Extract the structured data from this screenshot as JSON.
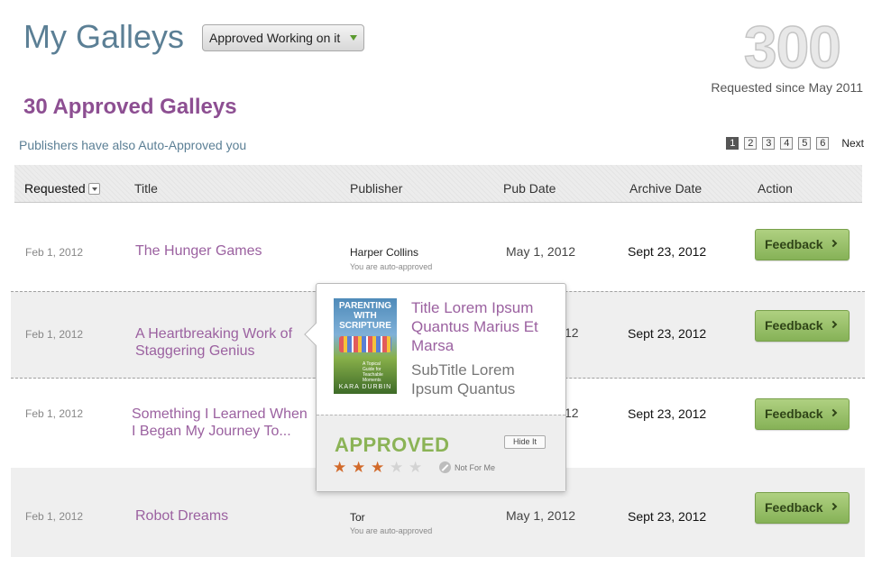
{
  "header": {
    "title": "My Galleys",
    "filter": {
      "selected": "Approved Working on it"
    },
    "stats": {
      "count": "300",
      "label": "Requested since May 2011"
    }
  },
  "section": {
    "title": "30 Approved Galleys",
    "auto_approved_link": "Publishers have also Auto-Approved you"
  },
  "pagination": {
    "pages": [
      "1",
      "2",
      "3",
      "4",
      "5",
      "6"
    ],
    "current": "1",
    "next_label": "Next"
  },
  "table": {
    "columns": {
      "requested": "Requested",
      "title": "Title",
      "publisher": "Publisher",
      "pub_date": "Pub Date",
      "archive_date": "Archive Date",
      "action": "Action"
    },
    "rows": [
      {
        "requested": "Feb 1, 2012",
        "title": "The Hunger Games",
        "publisher": "Harper Collins",
        "publisher_note": "You are auto-approved",
        "pub_date": "May 1, 2012",
        "archive_date": "Sept 23, 2012",
        "action": "Feedback"
      },
      {
        "requested": "Feb 1, 2012",
        "title": "A Heartbreaking Work of Staggering Genius",
        "publisher": "",
        "publisher_note": "",
        "pub_date": "12",
        "archive_date": "Sept 23, 2012",
        "action": "Feedback"
      },
      {
        "requested": "Feb 1, 2012",
        "title": "Something I Learned When I Began My Journey To...",
        "publisher": "",
        "publisher_note": "",
        "pub_date": "12",
        "archive_date": "Sept 23, 2012",
        "action": "Feedback"
      },
      {
        "requested": "Feb 1, 2012",
        "title": "Robot Dreams",
        "publisher": "Tor",
        "publisher_note": "You are auto-approved",
        "pub_date": "May 1, 2012",
        "archive_date": "Sept 23, 2012",
        "action": "Feedback"
      }
    ]
  },
  "popover": {
    "cover": {
      "title": "PARENTING WITH SCRIPTURE",
      "subtitle": "A Topical Guide for Teachable Moments",
      "author": "KARA DURBIN"
    },
    "title": "Title Lorem Ipsum Quantus Marius Et Marsa",
    "subtitle": "SubTitle Lorem Ipsum Quantus",
    "status": "APPROVED",
    "hide_label": "Hide It",
    "rating": 3,
    "max_rating": 5,
    "not_for_me_label": "Not For Me"
  },
  "colors": {
    "title_blue": "#5b7f95",
    "purple": "#9b61a0",
    "approved_green": "#8bb356",
    "star_orange": "#d26a2a"
  }
}
